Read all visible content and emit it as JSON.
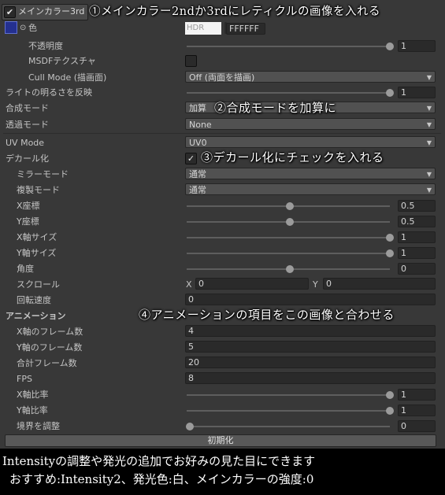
{
  "header": {
    "checkbox": "✔",
    "title": "メインカラー3rd"
  },
  "color_row": {
    "label": "色",
    "hdr": "HDR",
    "hex": "FFFFFF"
  },
  "rows": {
    "opacity": {
      "label": "不透明度",
      "value": "1",
      "level": 1
    },
    "msdf": {
      "label": "MSDFテクスチャ"
    },
    "cull": {
      "label": "Cull Mode (描画面)",
      "value": "Off (両面を描画)"
    },
    "light": {
      "label": "ライトの明るさを反映",
      "value": "1",
      "level": 1
    },
    "blend": {
      "label": "合成モード",
      "value": "加算"
    },
    "trans": {
      "label": "透過モード",
      "value": "None"
    },
    "uv": {
      "label": "UV Mode",
      "value": "UV0"
    },
    "decal": {
      "label": "デカール化",
      "check": "✓"
    },
    "mirror": {
      "label": "ミラーモード",
      "value": "通常"
    },
    "dup": {
      "label": "複製モード",
      "value": "通常"
    },
    "xpos": {
      "label": "X座標",
      "value": "0.5",
      "level": 0.5
    },
    "ypos": {
      "label": "Y座標",
      "value": "0.5",
      "level": 0.5
    },
    "xsize": {
      "label": "X軸サイズ",
      "value": "1",
      "level": 1
    },
    "ysize": {
      "label": "Y軸サイズ",
      "value": "1",
      "level": 1
    },
    "angle": {
      "label": "角度",
      "value": "0",
      "level": 0.5
    },
    "scroll": {
      "label": "スクロール",
      "x_label": "X",
      "x_value": "0",
      "y_label": "Y",
      "y_value": "0"
    },
    "rotspeed": {
      "label": "回転速度",
      "value": "0"
    }
  },
  "anim": {
    "heading": "アニメーション",
    "xframes": {
      "label": "X軸のフレーム数",
      "value": "4"
    },
    "yframes": {
      "label": "Y軸のフレーム数",
      "value": "5"
    },
    "total": {
      "label": "合計フレーム数",
      "value": "20"
    },
    "fps": {
      "label": "FPS",
      "value": "8"
    },
    "xratio": {
      "label": "X軸比率",
      "value": "1",
      "level": 1
    },
    "yratio": {
      "label": "Y軸比率",
      "value": "1",
      "level": 1
    },
    "border": {
      "label": "境界を調整",
      "value": "0",
      "level": 0
    }
  },
  "reset_button": "初期化",
  "annotations": {
    "a1": "①メインカラー2ndか3rdにレティクルの画像を入れる",
    "a2": "②合成モードを加算に",
    "a3": "③デカール化にチェックを入れる",
    "a4": "④アニメーションの項目をこの画像と合わせる"
  },
  "footer": {
    "line1": "Intensityの調整や発光の追加でお好みの見た目にできます",
    "line2": "おすすめ:Intensity2、発光色:白、メインカラーの強度:0"
  },
  "icons": {
    "dropdown": "▼",
    "eyedropper": "✎",
    "picker": "⊙"
  },
  "colors": {
    "panel": "#383838",
    "field": "#2a2a2a",
    "dropdown": "#515151",
    "knob": "#9b9b9b"
  }
}
